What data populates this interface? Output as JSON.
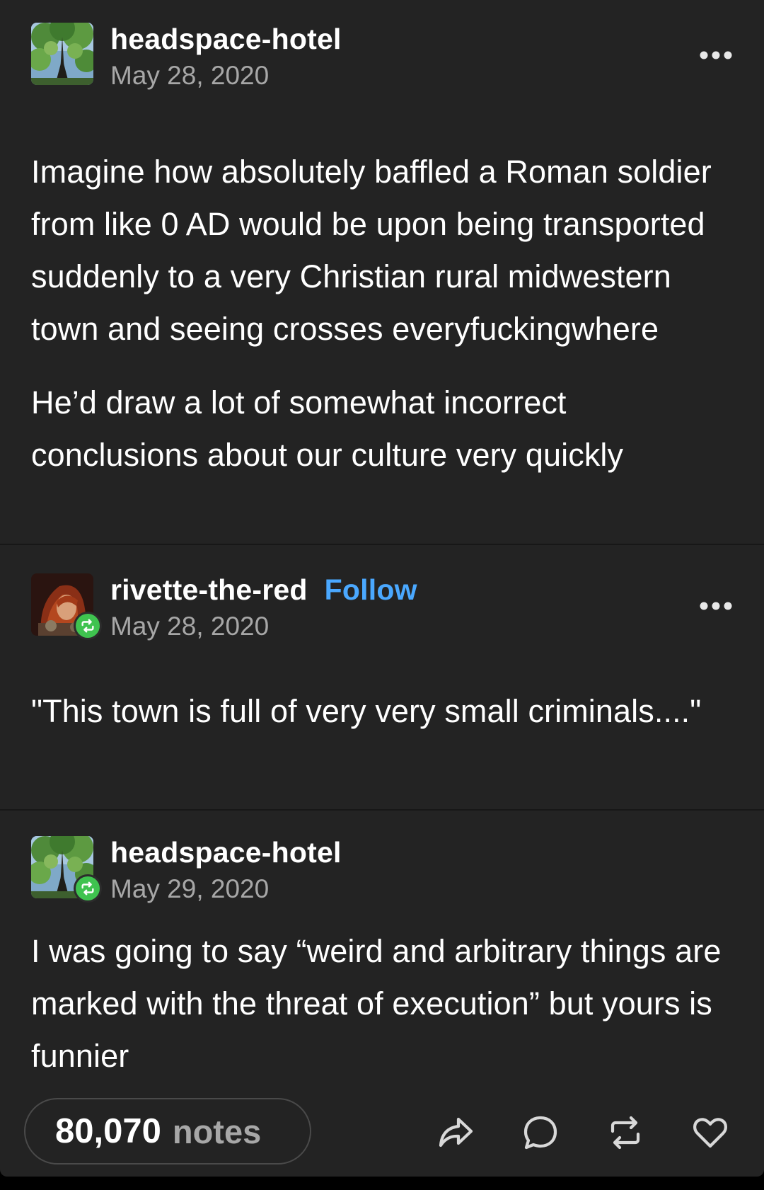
{
  "posts": [
    {
      "blog_name": "headspace-hotel",
      "date": "May 28, 2020",
      "paragraphs": [
        "Imagine how absolutely baffled a Roman soldier from like 0 AD would be upon being transported suddenly to a very Christian rural midwestern town and seeing crosses everyfuckingwhere",
        "He’d draw a lot of somewhat incorrect conclusions about our culture very quickly"
      ]
    },
    {
      "blog_name": "rivette-the-red",
      "follow_label": "Follow",
      "date": "May 28, 2020",
      "paragraphs": [
        "\"This town is full of very very small criminals....\""
      ]
    },
    {
      "blog_name": "headspace-hotel",
      "date": "May 29, 2020",
      "paragraphs": [
        "I was going to say “weird and arbitrary things are marked with the threat of execution” but yours is funnier"
      ]
    }
  ],
  "footer": {
    "notes_count": "80,070",
    "notes_label": "notes",
    "actions": [
      "share-icon",
      "reply-icon",
      "reblog-icon",
      "like-icon"
    ]
  },
  "icons": {
    "more": "more-options-icon",
    "reblog_badge": "reblog-badge-icon"
  },
  "colors": {
    "background": "#232323",
    "accent_blue": "#4aa8ff",
    "reblog_green": "#3fc34f",
    "secondary_text": "#a7a7a7"
  }
}
